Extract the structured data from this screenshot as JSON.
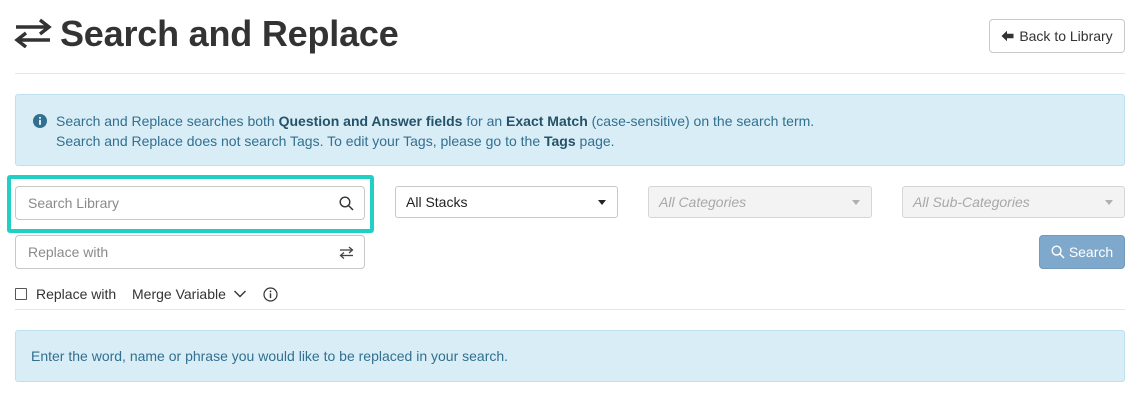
{
  "header": {
    "title_icon": "swap-arrows-icon",
    "title": "Search and Replace",
    "back_button": {
      "icon": "arrow-left-icon",
      "label": "Back to Library"
    }
  },
  "info_alert": {
    "icon": "info-circle-icon",
    "line1": {
      "t1": "Search and Replace searches both ",
      "b1": "Question and Answer fields",
      "t2": " for an ",
      "b2": "Exact Match",
      "t3": " (case-sensitive) on the search term."
    },
    "line2": {
      "t1": "Search and Replace does not search Tags. To edit your Tags, please go to the ",
      "link": "Tags",
      "t2": " page."
    }
  },
  "search": {
    "search_placeholder": "Search Library",
    "search_value": "",
    "search_icon": "magnifier-icon",
    "replace_placeholder": "Replace with",
    "replace_value": "",
    "replace_icon": "swap-arrows-icon",
    "stacks_select": "All Stacks",
    "categories_select": "All Categories",
    "subcategories_select": "All Sub-Categories",
    "search_button": "Search"
  },
  "options": {
    "checkbox_checked": false,
    "checkbox_label": "Replace with",
    "merge_label": "Merge Variable",
    "merge_icon": "chevron-down-icon",
    "help_icon": "info-circle-outline-icon"
  },
  "hint": {
    "text": "Enter the word, name or phrase you would like to be replaced in your search."
  },
  "colors": {
    "highlight": "#22cfc5",
    "info_bg": "#d9edf7",
    "info_text": "#31708f",
    "primary_button": "#7ea8cc"
  }
}
